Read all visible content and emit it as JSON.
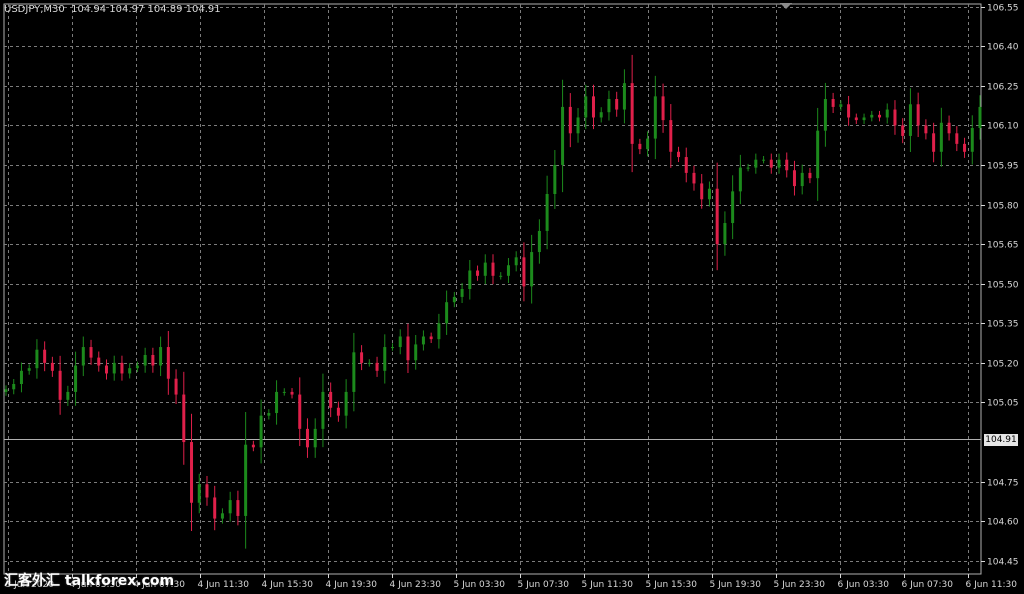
{
  "header": {
    "symbol": "USDJPY,M30",
    "ohlc": "104.94 104.97 104.89 104.91",
    "current_price": "104.91"
  },
  "watermark": {
    "text": "汇客外汇 talkforex.com"
  },
  "colors": {
    "background": "#000000",
    "grid": "#7c7c7c",
    "bull": "#1c8a1c",
    "bear": "#e0204a",
    "axis_text": "#d8d8d8",
    "price_line": "#b0b0b0"
  },
  "chart_data": {
    "type": "bar",
    "title": "USDJPY,M30",
    "ylim": [
      104.4,
      106.56
    ],
    "grid": true,
    "y_ticks": [
      "106.55",
      "106.40",
      "106.25",
      "106.10",
      "105.95",
      "105.80",
      "105.65",
      "105.50",
      "105.35",
      "105.20",
      "105.05",
      "104.91",
      "104.75",
      "104.60",
      "104.45"
    ],
    "x_ticks": [
      "3 Jun 2020",
      "4 Jun 03:30",
      "4 Jun 07:30",
      "4 Jun 11:30",
      "4 Jun 15:30",
      "4 Jun 19:30",
      "4 Jun 23:30",
      "5 Jun 03:30",
      "5 Jun 07:30",
      "5 Jun 11:30",
      "5 Jun 15:30",
      "5 Jun 19:30",
      "5 Jun 23:30",
      "6 Jun 03:30",
      "6 Jun 07:30",
      "6 Jun 11:30"
    ],
    "series": [
      {
        "close": [
          105.1,
          105.12,
          105.17,
          105.18,
          105.25,
          105.2,
          105.17,
          105.06,
          105.09,
          105.19,
          105.26,
          105.22,
          105.19,
          105.16,
          105.2,
          105.16,
          105.18,
          105.19,
          105.23,
          105.19,
          105.26,
          105.14,
          105.08,
          104.9,
          104.67,
          104.74,
          104.69,
          104.61,
          104.63,
          104.68,
          104.62,
          104.89,
          104.88,
          105.0,
          105.01,
          105.09,
          105.09,
          105.08,
          104.95,
          104.88,
          104.95,
          105.09,
          105.03,
          105.0,
          105.09,
          105.24,
          105.2,
          105.2,
          105.17,
          105.26,
          105.26,
          105.3,
          105.21,
          105.27,
          105.3,
          105.29,
          105.35,
          105.43,
          105.45,
          105.48,
          105.55,
          105.53,
          105.58,
          105.53,
          105.53,
          105.57,
          105.6,
          105.49,
          105.62,
          105.7,
          105.84,
          105.95,
          106.17,
          106.07,
          106.13,
          106.21,
          106.13,
          106.15,
          106.2,
          106.16,
          106.26,
          106.03,
          106.01,
          106.05,
          106.21,
          106.12,
          106.0,
          105.98,
          105.92,
          105.88,
          105.82,
          105.86,
          105.65,
          105.73,
          105.85,
          105.94,
          105.94,
          105.97,
          105.97,
          105.94,
          105.97,
          105.93,
          105.87,
          105.92,
          105.9,
          106.08,
          106.2,
          106.17,
          106.18,
          106.13,
          106.12,
          106.13,
          106.14,
          106.13,
          106.16,
          106.1,
          106.06,
          106.18,
          106.1,
          106.07,
          106.0,
          106.11,
          106.07,
          106.03,
          106.0,
          106.09,
          106.17
        ]
      }
    ]
  }
}
